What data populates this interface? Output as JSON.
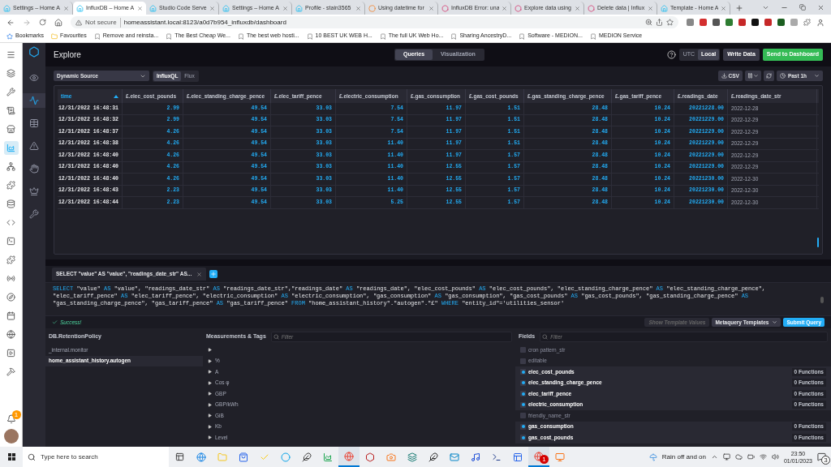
{
  "browser": {
    "tabs": [
      {
        "title": "Settings – Home A",
        "kind": "home",
        "selected": false
      },
      {
        "title": "InfluxDB – Home A",
        "kind": "home",
        "selected": true
      },
      {
        "title": "Studio Code Serve",
        "kind": "home",
        "selected": false
      },
      {
        "title": "Settings – Home A",
        "kind": "home",
        "selected": false
      },
      {
        "title": "Profile - stain3565",
        "kind": "home",
        "selected": false
      },
      {
        "title": "Using datetime for",
        "kind": "orange",
        "selected": false
      },
      {
        "title": "InfluxDB Error: una",
        "kind": "influx",
        "selected": false
      },
      {
        "title": "Explore data using",
        "kind": "influx",
        "selected": false
      },
      {
        "title": "Delete data | Influx",
        "kind": "influx",
        "selected": false
      },
      {
        "title": "Template - Home A",
        "kind": "home",
        "selected": false
      }
    ],
    "security": "Not secure",
    "url": "homeassistant.local:8123/a0d7b954_influxdb/dashboard",
    "bookmarks": [
      "Bookmarks",
      "Favourites",
      "Remove and reinsta...",
      "The Best Cheap We...",
      "The best web hosti...",
      "10 BEST UK WEB H...",
      "The full UK Web Ho...",
      "Sharing AncestryD...",
      "Software - MEDION...",
      "MEDION Service"
    ]
  },
  "ha_sidebar": {
    "items": [
      {
        "selected": false
      },
      {
        "selected": false
      },
      {
        "selected": false
      },
      {
        "selected": false
      },
      {
        "selected": false
      },
      {
        "selected": true
      },
      {
        "selected": false
      },
      {
        "selected": false
      },
      {
        "selected": false
      },
      {
        "selected": false
      },
      {
        "selected": false
      },
      {
        "selected": false
      },
      {
        "selected": false
      },
      {
        "selected": false
      },
      {
        "selected": false
      },
      {
        "selected": false
      },
      {
        "selected": false
      },
      {
        "selected": false
      }
    ],
    "notification_count": "1"
  },
  "influx_nav": {
    "items": [
      {
        "selected": false
      },
      {
        "selected": true
      },
      {
        "selected": false
      },
      {
        "selected": false
      },
      {
        "selected": false
      },
      {
        "selected": false
      },
      {
        "selected": false
      }
    ]
  },
  "header": {
    "title": "Explore",
    "modes": [
      {
        "label": "Queries",
        "selected": true
      },
      {
        "label": "Visualization",
        "selected": false
      }
    ],
    "timezones": [
      {
        "label": "UTC",
        "selected": false
      },
      {
        "label": "Local",
        "selected": true
      }
    ],
    "write_button": "Write Data",
    "send_button": "Send to Dashboard"
  },
  "controls": {
    "source": "Dynamic Source",
    "languages": [
      {
        "label": "InfluxQL",
        "selected": true
      },
      {
        "label": "Flux",
        "selected": false
      }
    ],
    "csv": "CSV",
    "range": "Past 1h"
  },
  "table": {
    "columns": [
      {
        "label": "time",
        "kind": "time",
        "sorted": true
      },
      {
        "label": "£.elec_cost_pounds",
        "kind": "number",
        "sorted": false
      },
      {
        "label": "£.elec_standing_charge_pence",
        "kind": "number",
        "sorted": false
      },
      {
        "label": "£.elec_tariff_pence",
        "kind": "number",
        "sorted": false
      },
      {
        "label": "£.electric_consumption",
        "kind": "number",
        "sorted": false
      },
      {
        "label": "£.gas_consumption",
        "kind": "number",
        "sorted": false
      },
      {
        "label": "£.gas_cost_pounds",
        "kind": "number",
        "sorted": false
      },
      {
        "label": "£.gas_standing_charge_pence",
        "kind": "number",
        "sorted": false
      },
      {
        "label": "£.gas_tariff_pence",
        "kind": "number",
        "sorted": false
      },
      {
        "label": "£.readings_date",
        "kind": "number",
        "sorted": false
      },
      {
        "label": "£.readings_date_str",
        "kind": "string",
        "sorted": false
      }
    ],
    "rows": [
      [
        "12/31/2022 16:48:31",
        "2.99",
        "49.54",
        "33.03",
        "7.54",
        "11.97",
        "1.51",
        "28.48",
        "10.24",
        "20221228.00",
        "2022-12-28"
      ],
      [
        "12/31/2022 16:48:32",
        "2.99",
        "49.54",
        "33.03",
        "7.54",
        "11.97",
        "1.51",
        "28.48",
        "10.24",
        "20221229.00",
        "2022-12-29"
      ],
      [
        "12/31/2022 16:48:37",
        "4.26",
        "49.54",
        "33.03",
        "7.54",
        "11.97",
        "1.51",
        "28.48",
        "10.24",
        "20221229.00",
        "2022-12-29"
      ],
      [
        "12/31/2022 16:48:38",
        "4.26",
        "49.54",
        "33.03",
        "11.40",
        "11.97",
        "1.51",
        "28.48",
        "10.24",
        "20221229.00",
        "2022-12-29"
      ],
      [
        "12/31/2022 16:48:40",
        "4.26",
        "49.54",
        "33.03",
        "11.40",
        "11.97",
        "1.57",
        "28.48",
        "10.24",
        "20221229.00",
        "2022-12-29"
      ],
      [
        "12/31/2022 16:48:40",
        "4.26",
        "49.54",
        "33.03",
        "11.40",
        "12.55",
        "1.57",
        "28.48",
        "10.24",
        "20221229.00",
        "2022-12-29"
      ],
      [
        "12/31/2022 16:48:40",
        "4.26",
        "49.54",
        "33.03",
        "11.40",
        "12.55",
        "1.57",
        "28.48",
        "10.24",
        "20221230.00",
        "2022-12-30"
      ],
      [
        "12/31/2022 16:48:43",
        "2.23",
        "49.54",
        "33.03",
        "11.40",
        "12.55",
        "1.57",
        "28.48",
        "10.24",
        "20221230.00",
        "2022-12-30"
      ],
      [
        "12/31/2022 16:48:44",
        "2.23",
        "49.54",
        "33.03",
        "5.25",
        "12.55",
        "1.57",
        "28.48",
        "10.24",
        "20221230.00",
        "2022-12-30"
      ]
    ]
  },
  "query": {
    "tab": "SELECT \"value\" AS \"value\", \"readings_date_str\" AS...",
    "tokens": [
      {
        "kind": "keyword",
        "text": "SELECT"
      },
      {
        "kind": "text",
        "text": "\"value\""
      },
      {
        "kind": "keyword",
        "text": "AS"
      },
      {
        "kind": "text",
        "text": "\"value\", \"readings_date_str\""
      },
      {
        "kind": "keyword",
        "text": "AS"
      },
      {
        "kind": "text",
        "text": "\"readings_date_str\",\"readings_date\""
      },
      {
        "kind": "keyword",
        "text": "AS"
      },
      {
        "kind": "text",
        "text": "\"readings_date\", \"elec_cost_pounds\""
      },
      {
        "kind": "keyword",
        "text": "AS"
      },
      {
        "kind": "text",
        "text": "\"elec_cost_pounds\", \"elec_standing_charge_pence\""
      },
      {
        "kind": "keyword",
        "text": "AS"
      },
      {
        "kind": "text",
        "text": "\"elec_standing_charge_pence\", \"elec_tariff_pence\""
      },
      {
        "kind": "keyword",
        "text": "AS"
      },
      {
        "kind": "text",
        "text": "\"elec_tariff_pence\", \"electric_consumption\""
      },
      {
        "kind": "keyword",
        "text": "AS"
      },
      {
        "kind": "text",
        "text": "\"electric_consumption\", \"gas_consumption\""
      },
      {
        "kind": "keyword",
        "text": "AS"
      },
      {
        "kind": "text",
        "text": "\"gas_consumption\", \"gas_cost_pounds\""
      },
      {
        "kind": "keyword",
        "text": "AS"
      },
      {
        "kind": "text",
        "text": "\"gas_cost_pounds\", \"gas_standing_charge_pence\""
      },
      {
        "kind": "keyword",
        "text": "AS"
      },
      {
        "kind": "text",
        "text": "\"gas_standing_charge_pence\", \"gas_tariff_pence\""
      },
      {
        "kind": "keyword",
        "text": "AS"
      },
      {
        "kind": "text",
        "text": "\"gas_tariff_pence\""
      },
      {
        "kind": "keyword",
        "text": "FROM"
      },
      {
        "kind": "text",
        "text": "\"home_assistant_history\".\"autogen\".\"£\""
      },
      {
        "kind": "keyword",
        "text": "WHERE"
      },
      {
        "kind": "text",
        "text": "\"entity_id\"='utilities_sensor'"
      }
    ],
    "status": "Success!",
    "template_button": "Show Template Values",
    "metaquery_button": "Metaquery Templates",
    "submit_button": "Submit Query"
  },
  "retention": {
    "title": "DB.RetentionPolicy",
    "items": [
      {
        "name": "_internal.monitor",
        "selected": false
      },
      {
        "name": "home_assistant_history.autogen",
        "selected": true
      }
    ]
  },
  "measurements": {
    "title": "Measurements & Tags",
    "placeholder": "Filter",
    "items": [
      {
        "expanded": false
      },
      {
        "name": "%",
        "expanded": false
      },
      {
        "name": "A",
        "expanded": false
      },
      {
        "name": "Cos φ",
        "expanded": false
      },
      {
        "name": "GBP",
        "expanded": false
      },
      {
        "name": "GBP/kWh",
        "expanded": false
      },
      {
        "name": "GiB",
        "expanded": false
      },
      {
        "name": "Kb",
        "expanded": false
      },
      {
        "name": "Level",
        "expanded": false
      }
    ]
  },
  "fields": {
    "title": "Fields",
    "placeholder": "Filter",
    "items": [
      {
        "name": "cron pattern_str",
        "selected": false
      },
      {
        "name": "editable",
        "selected": false
      },
      {
        "name": "elec_cost_pounds",
        "selected": true,
        "functions": "0 Functions"
      },
      {
        "name": "elec_standing_charge_pence",
        "selected": true,
        "functions": "0 Functions"
      },
      {
        "name": "elec_tariff_pence",
        "selected": true,
        "functions": "0 Functions"
      },
      {
        "name": "electric_consumption",
        "selected": true,
        "functions": "0 Functions"
      },
      {
        "name": "friendly_name_str",
        "selected": false
      },
      {
        "name": "gas_consumption",
        "selected": true,
        "functions": "0 Functions"
      },
      {
        "name": "gas_cost_pounds",
        "selected": true,
        "functions": "0 Functions"
      }
    ]
  },
  "taskbar": {
    "search_placeholder": "Type here to search",
    "apps": [
      {
        "active": false
      },
      {
        "active": false
      },
      {
        "active": false
      },
      {
        "active": false
      },
      {
        "active": false
      },
      {
        "active": false
      },
      {
        "active": false
      },
      {
        "active": true
      },
      {
        "active": false
      },
      {
        "active": false
      },
      {
        "active": false
      },
      {
        "active": false
      },
      {
        "active": false
      },
      {
        "active": false
      },
      {
        "active": false
      },
      {
        "active": false
      },
      {
        "active": true,
        "badge": "1"
      },
      {
        "active": false
      }
    ],
    "weather": "Rain off and on",
    "time": "23:50",
    "date": "01/01/2023",
    "notifications": "3"
  }
}
